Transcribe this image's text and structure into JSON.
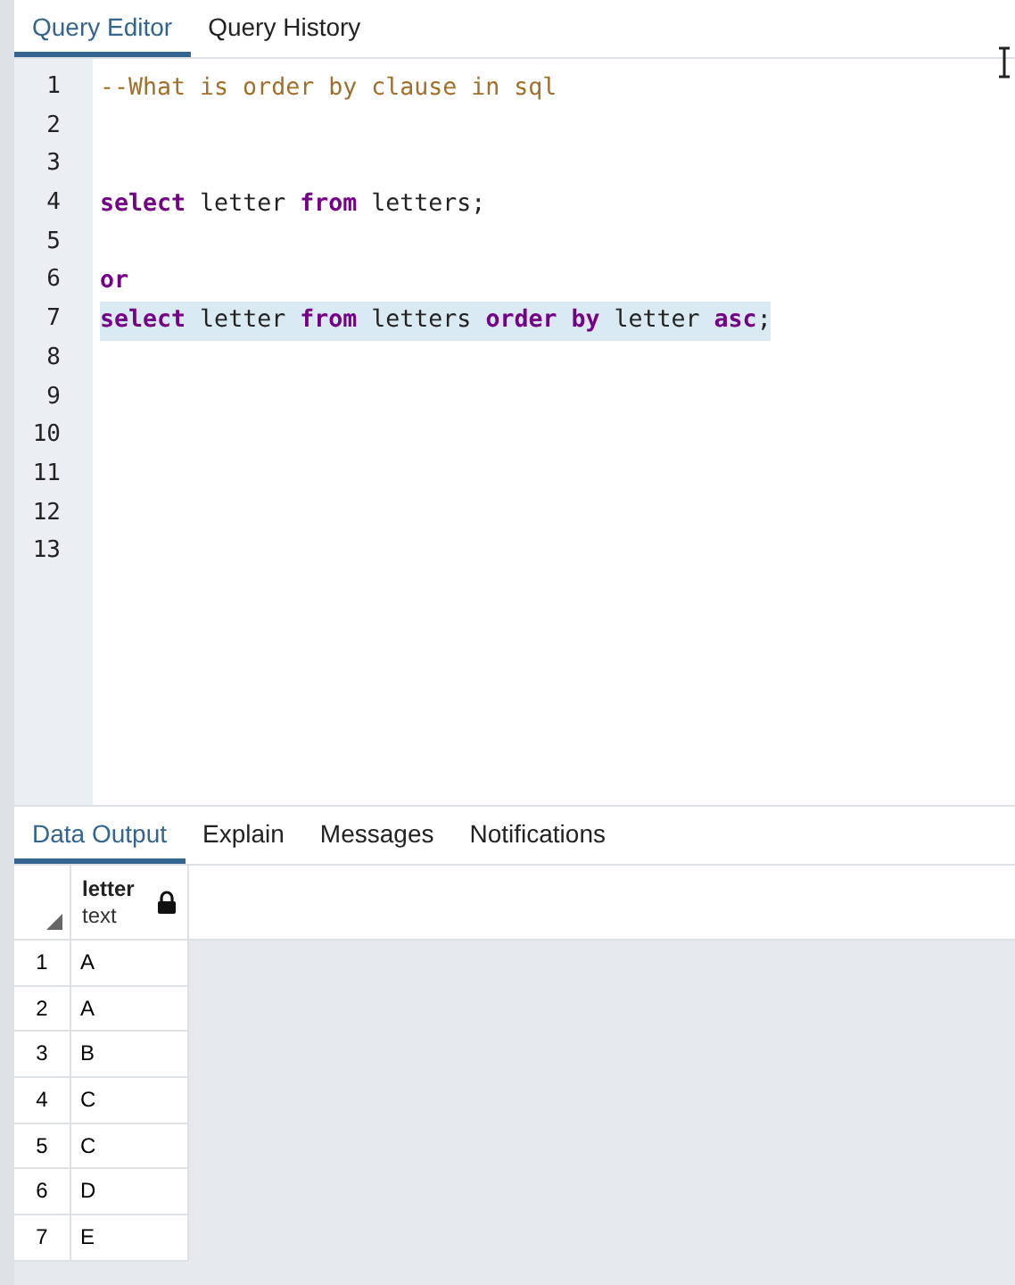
{
  "editor_tabs": [
    {
      "label": "Query Editor",
      "selected": true
    },
    {
      "label": "Query History",
      "selected": false
    }
  ],
  "code_lines": [
    {
      "number": "1",
      "highlighted": false,
      "tokens": [
        {
          "text": "--What is order by clause in sql",
          "kind": "comment"
        }
      ]
    },
    {
      "number": "2",
      "highlighted": false
    },
    {
      "number": "3",
      "highlighted": false
    },
    {
      "number": "4",
      "highlighted": false,
      "tokens": [
        {
          "text": "select",
          "kind": "keyword"
        },
        {
          "text": " letter ",
          "kind": "plain"
        },
        {
          "text": "from",
          "kind": "keyword"
        },
        {
          "text": " letters;",
          "kind": "plain"
        }
      ]
    },
    {
      "number": "5",
      "highlighted": false
    },
    {
      "number": "6",
      "highlighted": false,
      "tokens": [
        {
          "text": "or",
          "kind": "keyword"
        }
      ]
    },
    {
      "number": "7",
      "highlighted": true,
      "tokens": [
        {
          "text": "select",
          "kind": "keyword"
        },
        {
          "text": " letter ",
          "kind": "plain"
        },
        {
          "text": "from",
          "kind": "keyword"
        },
        {
          "text": " letters ",
          "kind": "plain"
        },
        {
          "text": "order by",
          "kind": "keyword"
        },
        {
          "text": " letter ",
          "kind": "plain"
        },
        {
          "text": "asc",
          "kind": "keyword"
        },
        {
          "text": ";",
          "kind": "plain"
        }
      ]
    },
    {
      "number": "8",
      "highlighted": false
    },
    {
      "number": "9",
      "highlighted": false
    },
    {
      "number": "10",
      "highlighted": false
    },
    {
      "number": "11",
      "highlighted": false
    },
    {
      "number": "12",
      "highlighted": false
    },
    {
      "number": "13",
      "highlighted": false
    }
  ],
  "output_tabs": [
    {
      "label": "Data Output",
      "selected": true
    },
    {
      "label": "Explain",
      "selected": false
    },
    {
      "label": "Messages",
      "selected": false
    },
    {
      "label": "Notifications",
      "selected": false
    }
  ],
  "table": {
    "columns": [
      {
        "name": "letter",
        "type": "text"
      }
    ],
    "rows": [
      {
        "number": "1",
        "cells": [
          "A"
        ]
      },
      {
        "number": "2",
        "cells": [
          "A"
        ]
      },
      {
        "number": "3",
        "cells": [
          "B"
        ]
      },
      {
        "number": "4",
        "cells": [
          "C"
        ]
      },
      {
        "number": "5",
        "cells": [
          "C"
        ]
      },
      {
        "number": "6",
        "cells": [
          "D"
        ]
      },
      {
        "number": "7",
        "cells": [
          "E"
        ]
      }
    ]
  }
}
